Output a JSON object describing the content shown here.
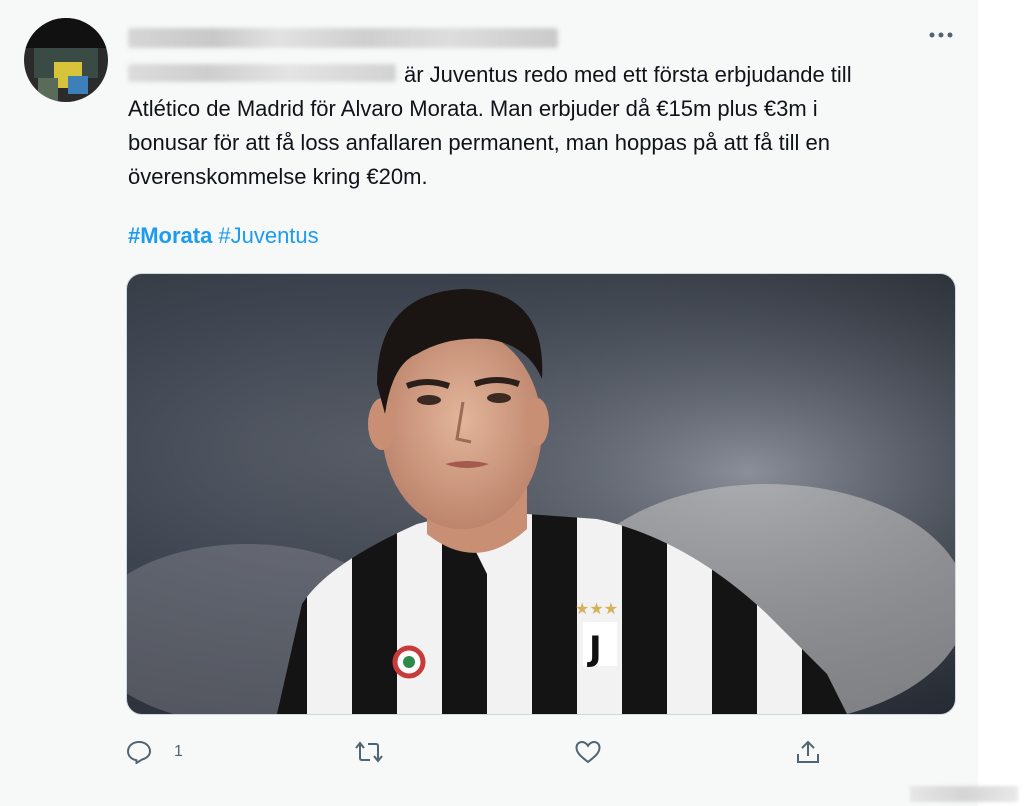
{
  "tweet": {
    "text_line1": "är Juventus redo med ett första erbjudande till",
    "text_line2": "Atlético de Madrid för Alvaro Morata. Man erbjuder då €15m plus €3m i",
    "text_line3": "bonusar för att få loss anfallaren permanent, man hoppas på att få till en",
    "text_line4": "överenskommelse kring €20m.",
    "hashtags": [
      "#Morata",
      "#Juventus"
    ]
  },
  "actions": {
    "reply_icon": "reply-icon",
    "reply_count": "1",
    "retweet_icon": "retweet-icon",
    "like_icon": "heart-icon",
    "share_icon": "share-icon"
  },
  "menu": {
    "more_icon": "more-horizontal-icon"
  },
  "colors": {
    "hashtag": "#1d9bf0",
    "text": "#0f1419",
    "muted": "#536471",
    "background": "#f7f9f9"
  }
}
